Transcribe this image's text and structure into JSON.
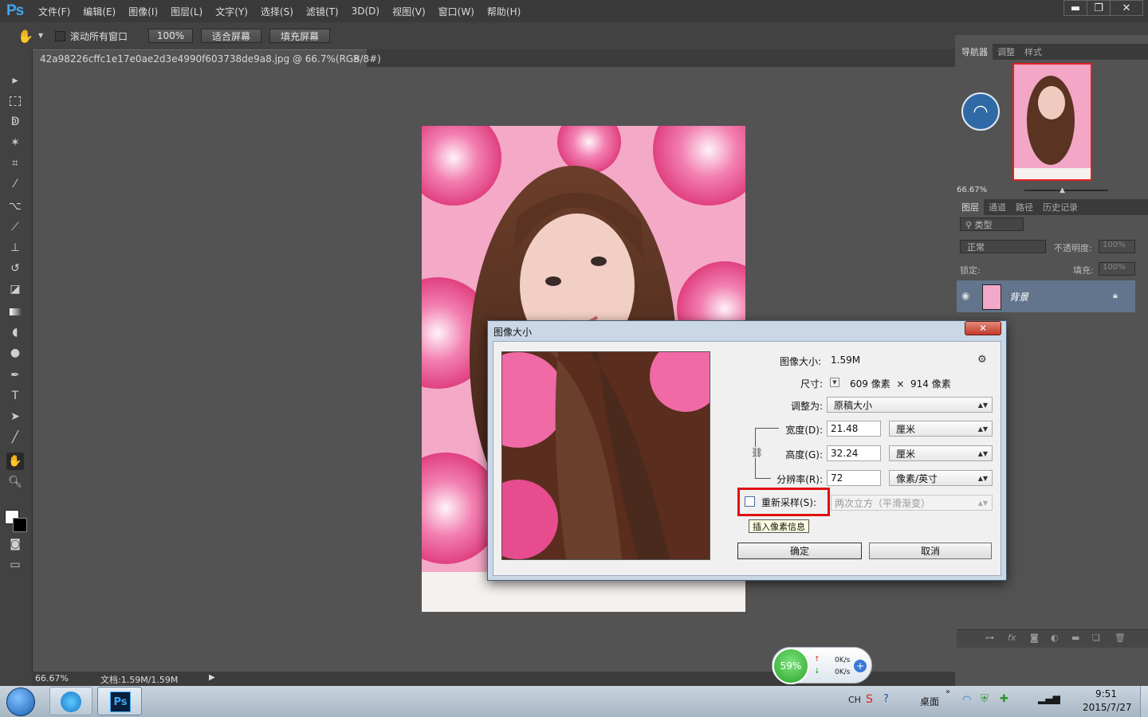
{
  "app": {
    "logo": "Ps"
  },
  "menu": [
    "文件(F)",
    "编辑(E)",
    "图像(I)",
    "图层(L)",
    "文字(Y)",
    "选择(S)",
    "滤镜(T)",
    "3D(D)",
    "视图(V)",
    "窗口(W)",
    "帮助(H)"
  ],
  "window_controls": {
    "minimize": "▬",
    "restore": "❐",
    "close": "✕"
  },
  "options": {
    "scroll_all_windows": "滚动所有窗口",
    "zoom_100": "100%",
    "fit_screen": "适合屏幕",
    "fill_screen": "填充屏幕"
  },
  "document": {
    "tab_title": "42a98226cffc1e17e0ae2d3e4990f603738de9a8.jpg @ 66.7%(RGB/8#)",
    "tab_close": "×"
  },
  "status": {
    "zoom": "66.67%",
    "doc_info": "文档:1.59M/1.59M"
  },
  "navigator": {
    "tabs": [
      "导航器",
      "调整",
      "样式"
    ],
    "zoom": "66.67%"
  },
  "layers": {
    "tabs": [
      "图层",
      "通道",
      "路径",
      "历史记录"
    ],
    "filter_kind": "类型",
    "blend_mode": "正常",
    "opacity_label": "不透明度:",
    "opacity_value": "100%",
    "lock_label": "锁定:",
    "fill_label": "填充:",
    "fill_value": "100%",
    "layer_name": "背景"
  },
  "dialog": {
    "title": "图像大小",
    "image_size_label": "图像大小:",
    "image_size_value": "1.59M",
    "dimensions_label": "尺寸:",
    "dimensions_value": "609 像素  ×  914 像素",
    "fit_to_label": "调整为:",
    "fit_to_value": "原稿大小",
    "width_label": "宽度(D):",
    "width_value": "21.48",
    "width_unit": "厘米",
    "height_label": "高度(G):",
    "height_value": "32.24",
    "height_unit": "厘米",
    "resolution_label": "分辨率(R):",
    "resolution_value": "72",
    "resolution_unit": "像素/英寸",
    "resample_label": "重新采样(S):",
    "resample_checked": false,
    "resample_method": "两次立方（平滑渐变）",
    "tooltip": "插入像素信息",
    "ok": "确定",
    "cancel": "取消",
    "close": "✕"
  },
  "speed_widget": {
    "percent": "59%",
    "up": "0K/s",
    "down": "0K/s"
  },
  "taskbar": {
    "ime": "CH",
    "desktop": "桌面",
    "time": "9:51",
    "date": "2015/7/27"
  },
  "colors": {
    "highlight_red": "#e01010",
    "accent_blue": "#3ea8f5",
    "selected_layer": "#62758c"
  }
}
